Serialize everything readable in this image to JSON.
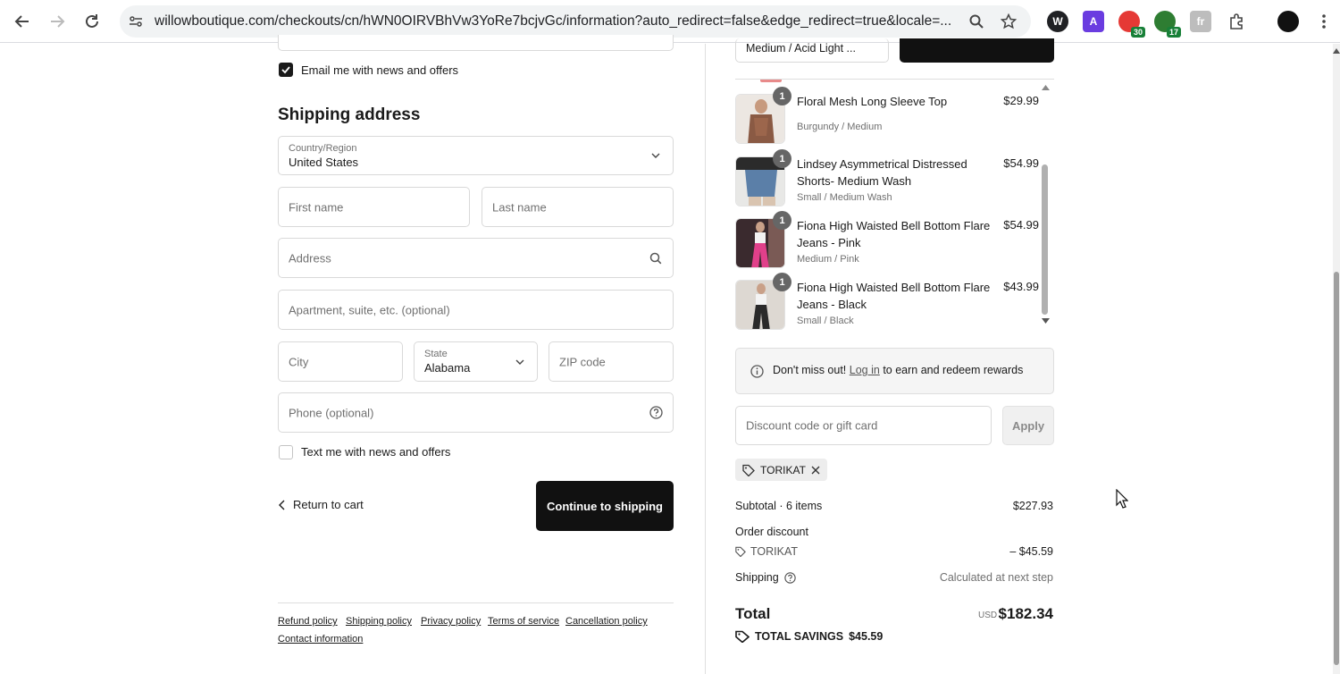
{
  "browser": {
    "url": "willowboutique.com/checkouts/cn/hWN0OIRVBhVw3YoRe7bcjvGc/information?auto_redirect=false&edge_redirect=true&locale=...",
    "extensions": [
      {
        "name": "w-extension",
        "letter": "W",
        "color": "#202124"
      },
      {
        "name": "a-extension",
        "letter": "A",
        "color": "#6a3ce0"
      },
      {
        "name": "red-extension",
        "letter": "",
        "color": "#e53935",
        "badge": "30"
      },
      {
        "name": "green-extension",
        "letter": "",
        "color": "#2e7d32",
        "badge": "17"
      },
      {
        "name": "grey-extension",
        "letter": "fr",
        "color": "#9e9e9e"
      }
    ]
  },
  "contact": {
    "email_checkbox_label": "Email me with news and offers",
    "email_checked": true
  },
  "shipping": {
    "title": "Shipping address",
    "country_label": "Country/Region",
    "country_value": "United States",
    "first_name_placeholder": "First name",
    "last_name_placeholder": "Last name",
    "address_placeholder": "Address",
    "apartment_placeholder": "Apartment, suite, etc. (optional)",
    "city_placeholder": "City",
    "state_label": "State",
    "state_value": "Alabama",
    "zip_placeholder": "ZIP code",
    "phone_placeholder": "Phone (optional)",
    "text_checkbox_label": "Text me with news and offers",
    "return_link": "Return to cart",
    "continue_button": "Continue to shipping"
  },
  "footer": {
    "links": [
      "Refund policy",
      "Shipping policy",
      "Privacy policy",
      "Terms of service",
      "Cancellation policy",
      "Contact information"
    ]
  },
  "upsell": {
    "variant_value": "Medium / Acid Light ..."
  },
  "products": [
    {
      "name": "Floral Mesh Long Sleeve Top",
      "variant": "Burgundy / Medium",
      "price": "$29.99",
      "qty": "1",
      "thumb_color": "#8a5a44"
    },
    {
      "name": "Lindsey Asymmetrical Distressed Shorts- Medium Wash",
      "variant": "Small / Medium Wash",
      "price": "$54.99",
      "qty": "1",
      "thumb_color": "#5b7fa8"
    },
    {
      "name": "Fiona High Waisted Bell Bottom Flare Jeans - Pink",
      "variant": "Medium / Pink",
      "price": "$54.99",
      "qty": "1",
      "thumb_color": "#e0408a"
    },
    {
      "name": "Fiona High Waisted Bell Bottom Flare Jeans - Black",
      "variant": "Small / Black",
      "price": "$43.99",
      "qty": "1",
      "thumb_color": "#2a2a2a"
    }
  ],
  "rewards": {
    "prefix": "Don't miss out!",
    "link": "Log in",
    "suffix": "to earn and redeem rewards"
  },
  "discount": {
    "placeholder": "Discount code or gift card",
    "apply_button": "Apply",
    "applied_code": "TORIKAT"
  },
  "summary": {
    "subtotal_label": "Subtotal · 6 items",
    "subtotal_value": "$227.93",
    "order_discount_label": "Order discount",
    "discount_code": "TORIKAT",
    "discount_value": "– $45.59",
    "shipping_label": "Shipping",
    "shipping_value": "Calculated at next step",
    "total_label": "Total",
    "currency": "USD",
    "total_value": "$182.34",
    "savings_label": "TOTAL SAVINGS",
    "savings_value": "$45.59"
  }
}
